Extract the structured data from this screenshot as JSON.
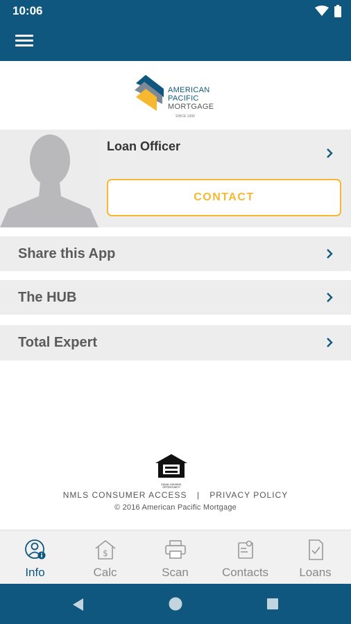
{
  "status_bar": {
    "time": "10:06"
  },
  "logo": {
    "line1": "AMERICAN",
    "line2": "PACIFIC",
    "line3": "MORTGAGE",
    "since": "SINCE 1999"
  },
  "officer": {
    "title": "Loan Officer",
    "contact_label": "CONTACT"
  },
  "menu_rows": [
    {
      "label": "Share this App"
    },
    {
      "label": "The HUB"
    },
    {
      "label": "Total Expert"
    }
  ],
  "footer": {
    "nmls_link": "NMLS CONSUMER ACCESS",
    "separator": "|",
    "privacy_link": "PRIVACY POLICY",
    "copyright": "© 2016 American Pacific Mortgage",
    "eho_text": "EQUAL HOUSING OPPORTUNITY"
  },
  "tabs": [
    {
      "label": "Info",
      "icon": "info-person-icon",
      "active": true
    },
    {
      "label": "Calc",
      "icon": "house-dollar-icon",
      "active": false
    },
    {
      "label": "Scan",
      "icon": "printer-icon",
      "active": false
    },
    {
      "label": "Contacts",
      "icon": "contacts-icon",
      "active": false
    },
    {
      "label": "Loans",
      "icon": "document-check-icon",
      "active": false
    }
  ],
  "colors": {
    "primary": "#0f577e",
    "accent": "#f5b82e",
    "row_bg": "#ededed",
    "muted_text": "#888888"
  }
}
